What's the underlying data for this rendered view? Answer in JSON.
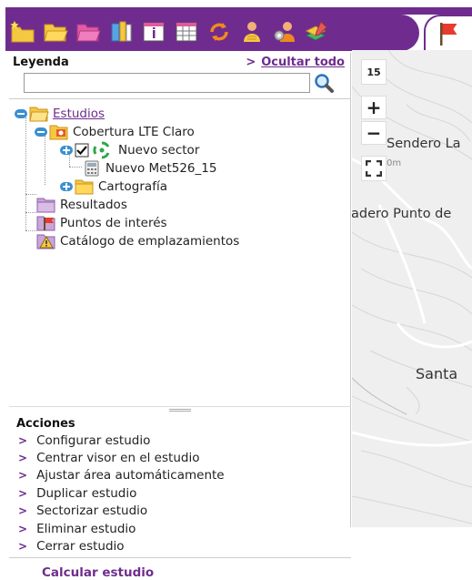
{
  "toolbar": {
    "icons": [
      "new-study-icon",
      "open-folder-icon",
      "folder-icon",
      "library-icon",
      "info-window-icon",
      "table-icon",
      "refresh-icon",
      "user-group-icon",
      "user-settings-icon",
      "layers-edit-icon",
      "flag-icon"
    ]
  },
  "legend": {
    "title": "Leyenda",
    "hide_all": "Ocultar todo",
    "search_value": ""
  },
  "tree": {
    "estudios": "Estudios",
    "cobertura": "Cobertura LTE Claro",
    "nuevo_sector": "Nuevo sector",
    "nuevo_met": "Nuevo Met526_15",
    "cartografia": "Cartografía",
    "resultados": "Resultados",
    "puntos": "Puntos de interés",
    "catalogo": "Catálogo de emplazamientos"
  },
  "actions": {
    "title": "Acciones",
    "items": [
      "Configurar estudio",
      "Centrar visor en el estudio",
      "Ajustar área automáticamente",
      "Duplicar estudio",
      "Sectorizar estudio",
      "Eliminar estudio",
      "Cerrar estudio"
    ],
    "calculate": "Calcular estudio"
  },
  "map": {
    "zoom_level": "15",
    "zoom_in": "+",
    "zoom_out": "−",
    "labels": {
      "sendero": "Sendero La",
      "elev": "0m",
      "mirador": "adero Punto de",
      "santa": "Santa"
    }
  },
  "colors": {
    "accent": "#6f2c8e",
    "folder": "#f5c842",
    "expander": "#3a8fd0"
  }
}
